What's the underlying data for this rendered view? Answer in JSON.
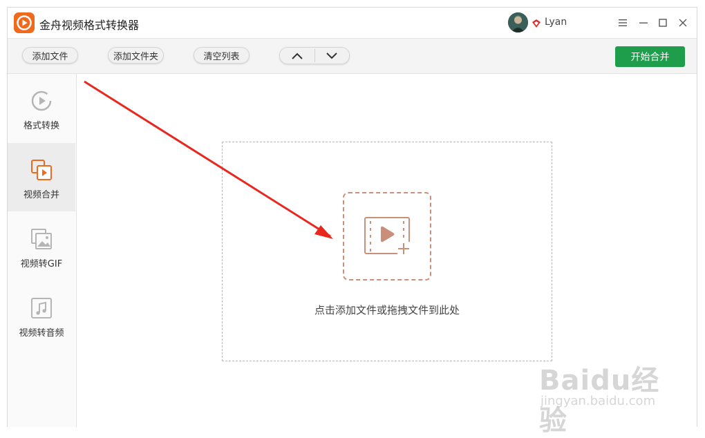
{
  "app": {
    "title": "金舟视频格式转换器",
    "username": "Lyan"
  },
  "toolbar": {
    "add_file": "添加文件",
    "add_folder": "添加文件夹",
    "clear_list": "清空列表",
    "start": "开始合并"
  },
  "sidebar": {
    "items": [
      {
        "label": "格式转换",
        "icon": "play-circle-icon",
        "active": false
      },
      {
        "label": "视频合并",
        "icon": "video-merge-icon",
        "active": true
      },
      {
        "label": "视频转GIF",
        "icon": "image-gif-icon",
        "active": false
      },
      {
        "label": "视频转音频",
        "icon": "music-note-icon",
        "active": false
      }
    ]
  },
  "main": {
    "drop_hint": "点击添加文件或拖拽文件到此处"
  },
  "watermark": {
    "brand": "Baidu经验",
    "url": "jingyan.baidu.com"
  },
  "colors": {
    "accent": "#f06a1d",
    "start_button": "#1e9e4a",
    "dropzone_icon": "#c98f7a",
    "annotation_arrow": "#e8281f"
  }
}
